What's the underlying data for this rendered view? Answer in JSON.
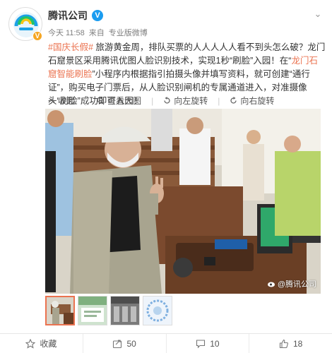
{
  "header": {
    "user_name": "腾讯公司",
    "verified_mark": "V",
    "time": "今天 11:58",
    "via_prefix": "来自",
    "source": "专业版微博",
    "more_glyph": "⌄"
  },
  "post": {
    "tag1": "#国庆长假#",
    "text1": " 旅游黄金周，排队买票的人人人人人看不到头怎么破？龙门石窟景区采用腾讯优图人脸识别技术，实现1秒“刷脸”入园！在“",
    "tag2": "龙门石窟智能刷脸",
    "text2": "”小程序内根据指引拍摄头像并填写资料，就可创建“通行证”，购买电子门票后，从人脸识别闸机的专属通道进入，对准摄像头“刷脸”成功即可入园！"
  },
  "toolbar": {
    "collapse": "收起",
    "view_large": "查看大图",
    "rotate_left": "向左旋转",
    "rotate_right": "向右旋转"
  },
  "photo": {
    "watermark": "@腾讯公司"
  },
  "actions": {
    "favorite": "收藏",
    "share_count": "50",
    "comment_count": "10",
    "like_count": "18"
  },
  "colors": {
    "accent": "#eb7350",
    "verified": "#1a9cf0"
  }
}
